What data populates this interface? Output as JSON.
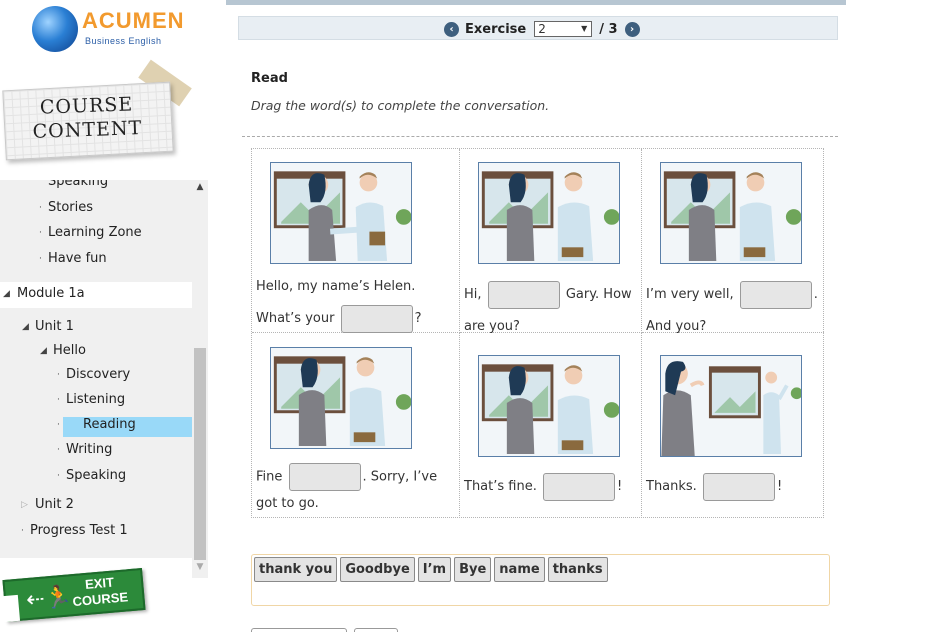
{
  "logo": {
    "brand": "ACUMEN",
    "subtitle": "Business English"
  },
  "course_note": {
    "line1": "COURSE",
    "line2": "CONTENT"
  },
  "tree": {
    "items": [
      {
        "label": "Speaking",
        "marker": ""
      },
      {
        "label": "Stories",
        "marker": "·"
      },
      {
        "label": "Learning Zone",
        "marker": "·"
      },
      {
        "label": "Have fun",
        "marker": "·"
      },
      {
        "label": "Module 1a",
        "marker": "◢"
      },
      {
        "label": "Unit 1",
        "marker": "◢"
      },
      {
        "label": "Hello",
        "marker": "◢"
      },
      {
        "label": "Discovery",
        "marker": "·"
      },
      {
        "label": "Listening",
        "marker": "·"
      },
      {
        "label": "Reading",
        "marker": "·"
      },
      {
        "label": "Writing",
        "marker": "·"
      },
      {
        "label": "Speaking",
        "marker": "·"
      },
      {
        "label": "Unit 2",
        "marker": "▷"
      },
      {
        "label": "Progress Test 1",
        "marker": "·"
      }
    ],
    "scroll_up": "▲",
    "scroll_down": "▼"
  },
  "exit": {
    "line1": "EXIT",
    "line2": "COURSE"
  },
  "exercise_nav": {
    "prev": "‹",
    "label": "Exercise",
    "current": "2",
    "total": "/ 3",
    "next": "›",
    "dropdown_arrow": "▼"
  },
  "section": {
    "title": "Read",
    "instructions": "Drag the word(s) to complete the conversation."
  },
  "cells": [
    {
      "before": "Hello, my name’s Helen. What’s your",
      "after": "?"
    },
    {
      "before": "Hi,",
      "after": "Gary. How are you?"
    },
    {
      "before": "I’m very well,",
      "after": ". And you?"
    },
    {
      "before": "Fine",
      "after": ". Sorry, I’ve got to go."
    },
    {
      "before": "That’s fine.",
      "after": "!"
    },
    {
      "before": "Thanks.",
      "after": "!"
    }
  ],
  "word_bank": [
    "thank you",
    "Goodbye",
    "I’m",
    "Bye",
    "name",
    "thanks"
  ],
  "colors": {
    "selected_row": "#99d9f8",
    "exit_sign": "#2c8a3a",
    "nav_button": "#3e5f7e",
    "word_bank_border": "#f0d6a6"
  }
}
